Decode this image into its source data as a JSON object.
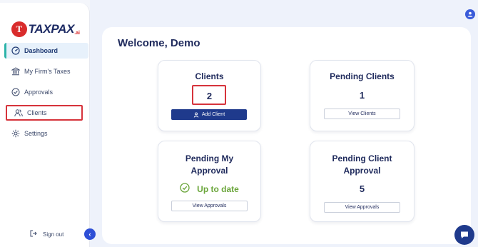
{
  "brand": {
    "logo_letter": "T",
    "name": "TAXPAX",
    "suffix": ".ai",
    "colors": {
      "red": "#d92c2c",
      "navy": "#1d2b64",
      "accent": "#2bb3a8",
      "button": "#1f3a8c",
      "highlight": "#d6333b"
    }
  },
  "sidebar": {
    "items": [
      {
        "label": "Dashboard",
        "icon": "gauge-icon",
        "active": true
      },
      {
        "label": "My Firm's Taxes",
        "icon": "bank-icon"
      },
      {
        "label": "Approvals",
        "icon": "check-circle-icon"
      },
      {
        "label": "Clients",
        "icon": "users-icon",
        "highlighted": true
      },
      {
        "label": "Settings",
        "icon": "gear-icon"
      }
    ],
    "sign_out": "Sign out",
    "collapse_icon": "chevron-left-icon"
  },
  "header": {
    "avatar_icon": "user-icon"
  },
  "main": {
    "welcome": "Welcome, Demo",
    "cards": [
      {
        "title": "Clients",
        "value": "2",
        "button": "Add Client",
        "button_icon": "add-user-icon"
      },
      {
        "title": "Pending Clients",
        "value": "1",
        "button": "View Clients"
      },
      {
        "title_line1": "Pending My",
        "title_line2": "Approval",
        "status": "Up to date",
        "status_icon": "check-circle-icon",
        "button": "View Approvals"
      },
      {
        "title_line1": "Pending Client",
        "title_line2": "Approval",
        "value": "5",
        "button": "View Approvals"
      }
    ]
  },
  "chat": {
    "icon": "chat-bubble-icon"
  }
}
